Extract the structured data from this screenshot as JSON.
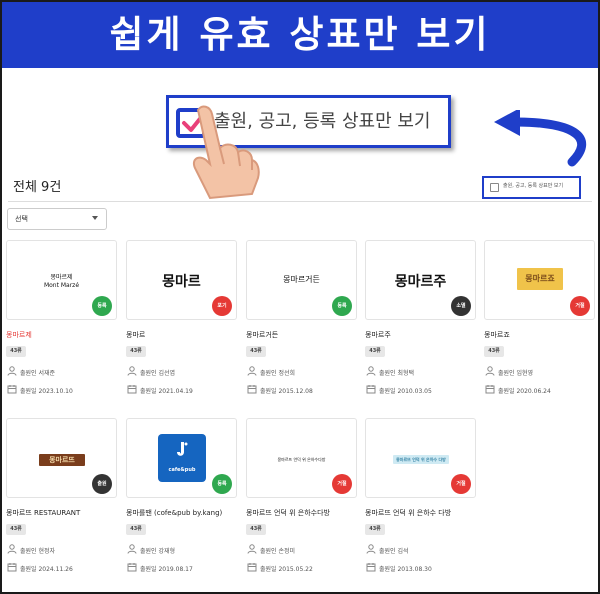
{
  "banner": {
    "title": "쉽게 유효 상표만 보기"
  },
  "callout": {
    "label": "출원, 공고, 등록 상표만 보기"
  },
  "list_header": {
    "total": "전체 9건",
    "filter_label": "출원, 공고, 등록 상표만 보기"
  },
  "sort_select": {
    "value": "선택"
  },
  "cards": [
    {
      "thumb_lines": [
        "몽마르제",
        "Mont Marzé"
      ],
      "status": "등록",
      "status_color": "#2fa84f",
      "title": "몽마르제",
      "title_color": "#e53935",
      "class": "43류",
      "applicant": "출원인  서재준",
      "date": "출원일  2023.10.10"
    },
    {
      "thumb_lines": [
        "몽마르"
      ],
      "status": "포기",
      "status_color": "#e53935",
      "title": "몽마르",
      "title_color": "#222222",
      "class": "43류",
      "applicant": "출원인  김선엽",
      "date": "출원일  2021.04.19"
    },
    {
      "thumb_lines": [
        "몽마르거든"
      ],
      "status": "등록",
      "status_color": "#2fa84f",
      "title": "몽마르거든",
      "title_color": "#222222",
      "class": "43류",
      "applicant": "출원인  정선희",
      "date": "출원일  2015.12.08"
    },
    {
      "thumb_lines": [
        "몽마르주"
      ],
      "status": "소멸",
      "status_color": "#333333",
      "title": "몽마르주",
      "title_color": "#222222",
      "class": "43류",
      "applicant": "출원인  최형택",
      "date": "출원일  2010.03.05"
    },
    {
      "thumb_lines": [
        "몽마르죠"
      ],
      "status": "거절",
      "status_color": "#e53935",
      "title": "몽마르죠",
      "title_color": "#222222",
      "class": "43류",
      "applicant": "출원인  임현영",
      "date": "출원일  2020.06.24"
    },
    {
      "thumb_lines": [
        "몽마르뜨"
      ],
      "status": "출원",
      "status_color": "#333333",
      "title": "몽마르뜨 RESTAURANT",
      "title_color": "#222222",
      "class": "43류",
      "applicant": "출원인  현정자",
      "date": "출원일  2024.11.26"
    },
    {
      "thumb_lines": [
        "cafe&pub"
      ],
      "status": "등록",
      "status_color": "#2fa84f",
      "title": "몽마를땐 (cofe&pub by.kang)",
      "title_color": "#222222",
      "class": "43류",
      "applicant": "출원인  강재형",
      "date": "출원일  2019.08.17"
    },
    {
      "thumb_lines": [
        "몽마르뜨 언덕 위 은하수다방"
      ],
      "status": "거절",
      "status_color": "#e53935",
      "title": "몽마르뜨 언덕 위 은하수다방",
      "title_color": "#222222",
      "class": "43류",
      "applicant": "출원인  손정미",
      "date": "출원일  2015.05.22"
    },
    {
      "thumb_lines": [
        "몽마르뜨 언덕 위 은하수 다방"
      ],
      "status": "거절",
      "status_color": "#e53935",
      "title": "몽마르뜨 언덕 위 은하수 다방",
      "title_color": "#222222",
      "class": "43류",
      "applicant": "출원인  김석",
      "date": "출원일  2013.08.30"
    }
  ]
}
